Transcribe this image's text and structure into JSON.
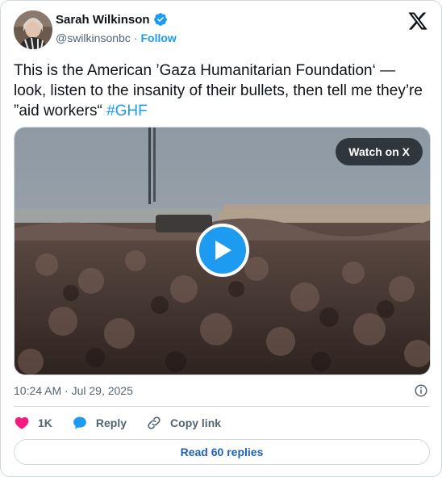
{
  "author": {
    "name": "Sarah Wilkinson",
    "handle": "@swilkinsonbc",
    "separator": "·",
    "follow_label": "Follow",
    "verified_color": "#1d9bf0"
  },
  "tweet": {
    "text": "This is the American ’Gaza Humanitarian Foundation‘ — look, listen to the insanity of their bullets, then tell me they’re ”aid workers“ ",
    "hashtag": "#GHF"
  },
  "media": {
    "watch_label": "Watch on X",
    "play_icon": "play-icon"
  },
  "timestamp": "10:24 AM · Jul 29, 2025",
  "actions": {
    "likes": "1K",
    "reply_label": "Reply",
    "copy_label": "Copy link"
  },
  "replies_button": "Read 60 replies",
  "colors": {
    "accent": "#1d9bf0",
    "like": "#f91880",
    "text": "#0f1419",
    "muted": "#536471",
    "border": "#cfd9de"
  }
}
